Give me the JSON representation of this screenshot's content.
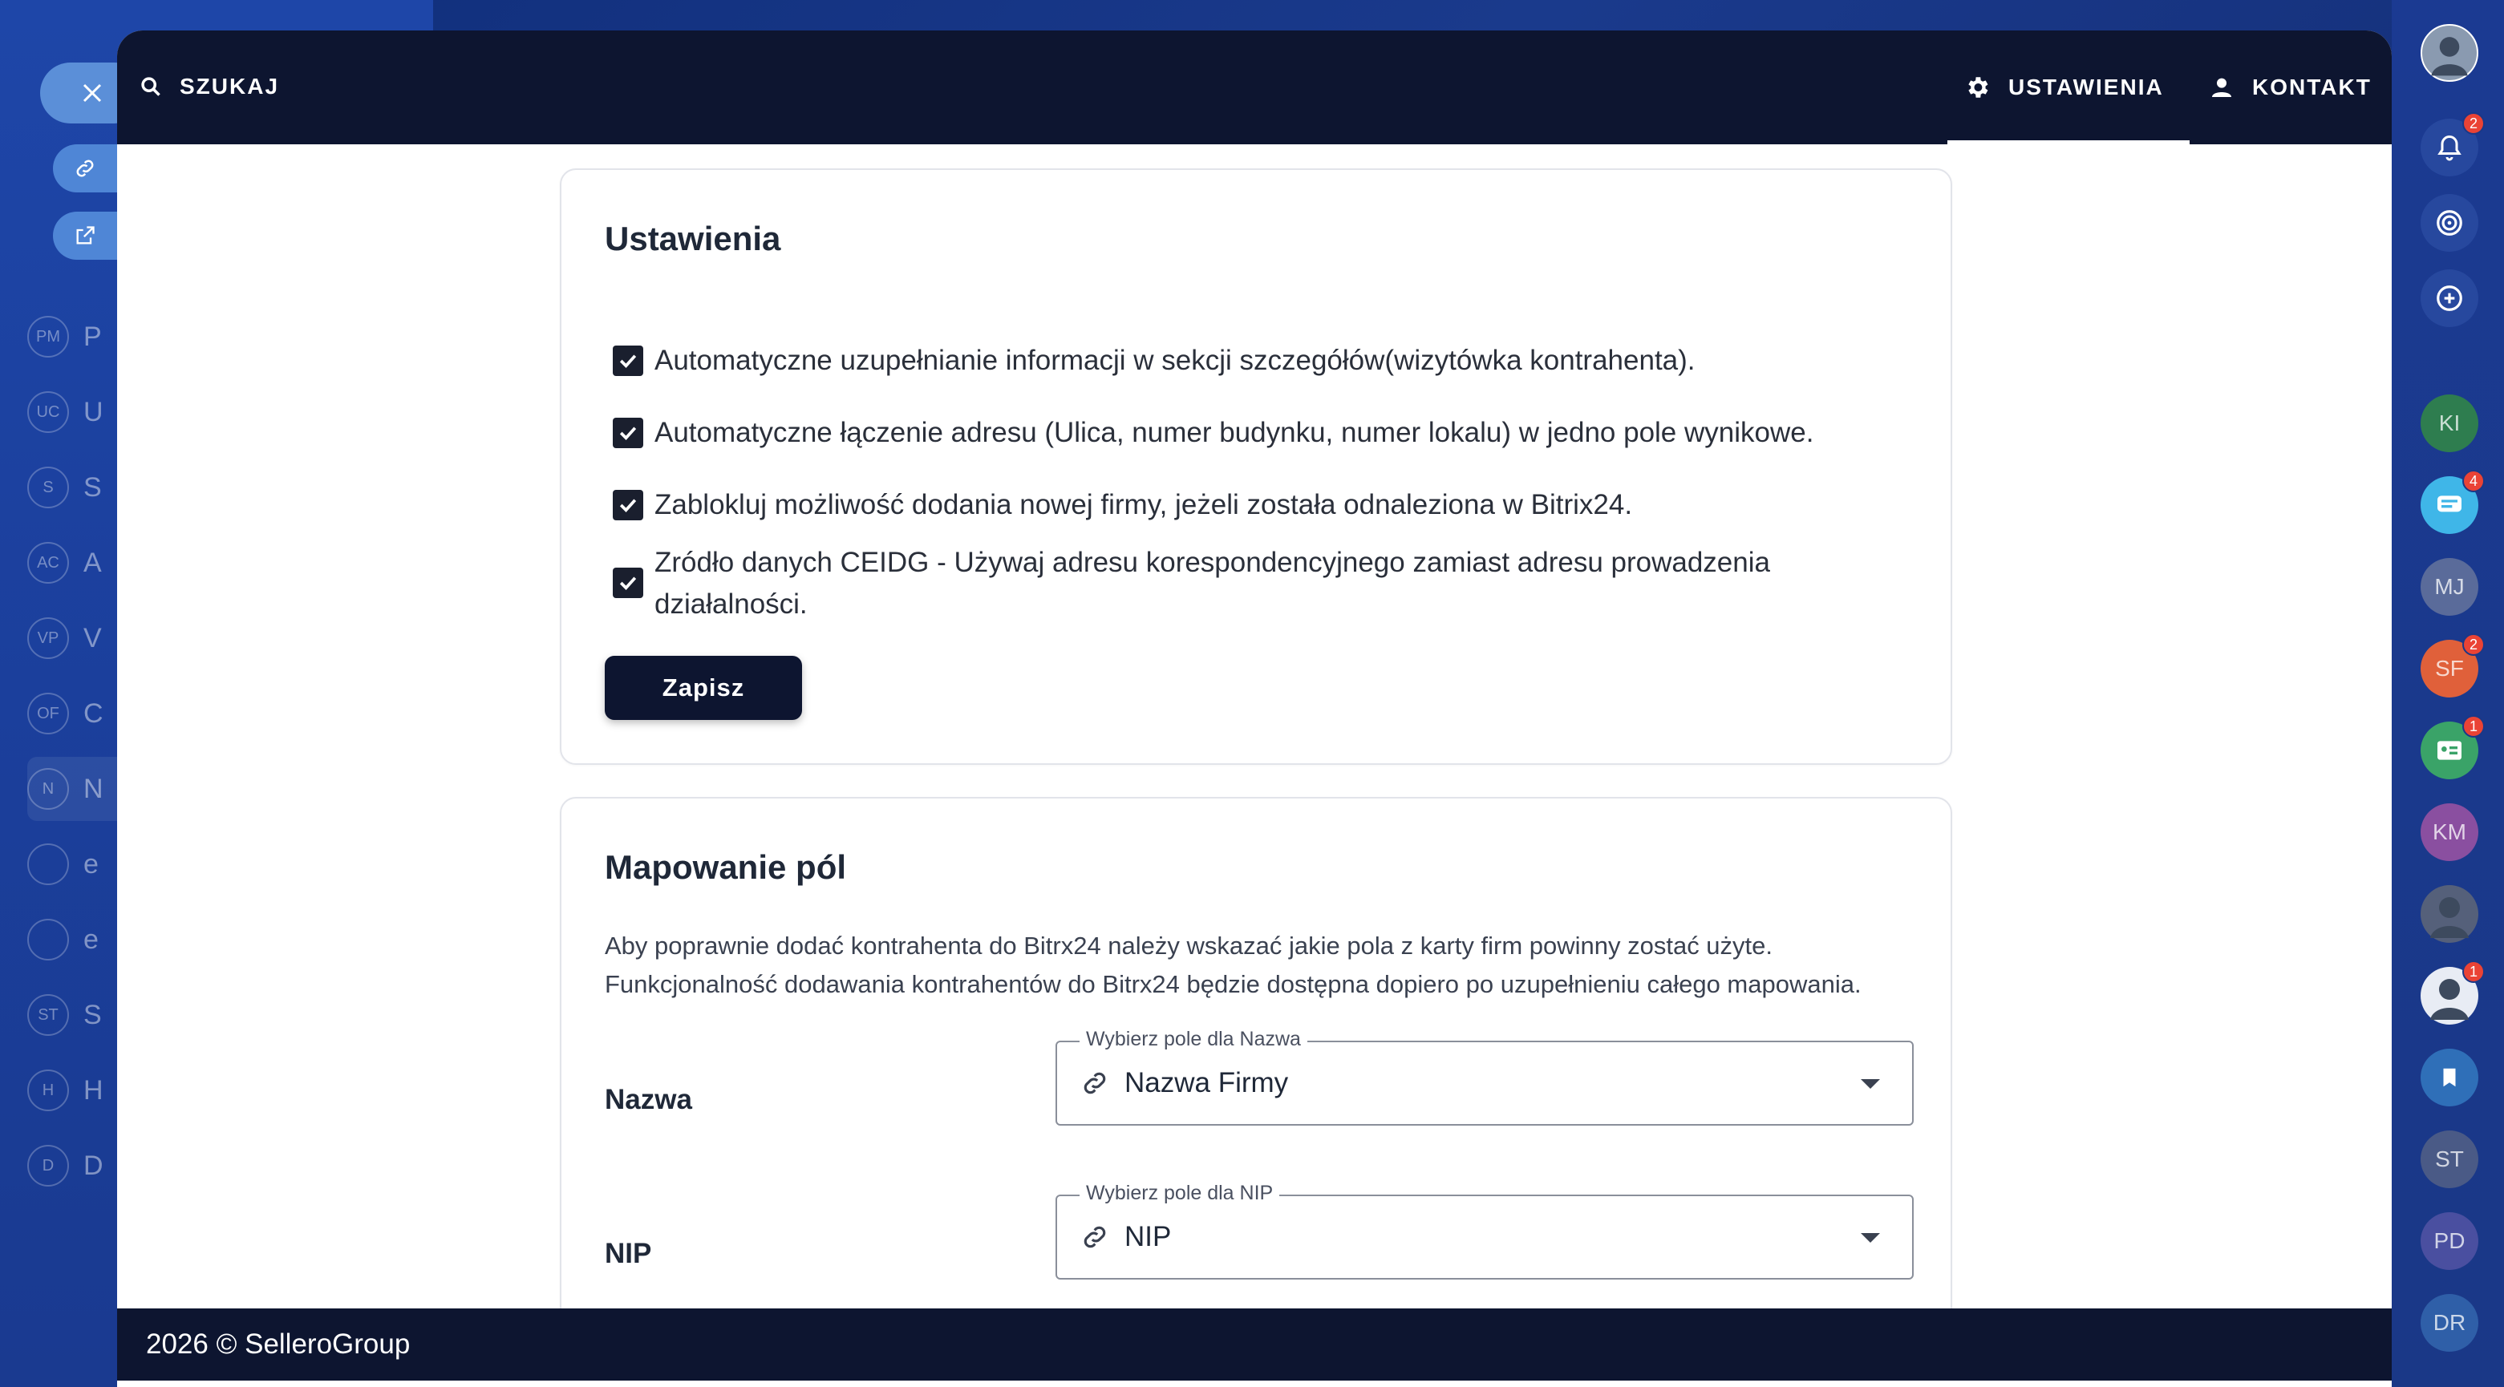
{
  "topbar": {
    "search_label": "SZUKAJ",
    "tabs": [
      {
        "label": "USTAWIENIA",
        "icon": "gear-icon",
        "active": true
      },
      {
        "label": "KONTAKT",
        "icon": "person-icon",
        "active": false
      }
    ]
  },
  "settings_card": {
    "title": "Ustawienia",
    "options": [
      {
        "label": "Automatyczne uzupełnianie informacji w sekcji szczegółów(wizytówka kontrahenta).",
        "checked": true
      },
      {
        "label": "Automatyczne łączenie adresu (Ulica, numer budynku, numer lokalu) w jedno pole wynikowe.",
        "checked": true
      },
      {
        "label": "Zablokluj możliwość dodania nowej firmy, jeżeli została odnaleziona w Bitrix24.",
        "checked": true
      },
      {
        "label": "Zródło danych CEIDG - Używaj adresu korespondencyjnego zamiast adresu prowadzenia działalności.",
        "checked": true
      }
    ],
    "save_label": "Zapisz"
  },
  "mapping_card": {
    "title": "Mapowanie pól",
    "description_1": "Aby poprawnie dodać kontrahenta do Bitrx24 należy wskazać jakie pola z karty firm powinny zostać użyte.",
    "description_2": "Funkcjonalność dodawania kontrahentów do Bitrx24 będzie dostępna dopiero po uzupełnieniu całego mapowania.",
    "fields": [
      {
        "label": "Nazwa",
        "legend": "Wybierz pole dla Nazwa",
        "value": "Nazwa Firmy"
      },
      {
        "label": "NIP",
        "legend": "Wybierz pole dla NIP",
        "value": "NIP"
      }
    ]
  },
  "footer": {
    "text": "2026 © SelleroGroup"
  },
  "background_nav": [
    {
      "initials": "PM",
      "letter": "P"
    },
    {
      "initials": "UC",
      "letter": "U"
    },
    {
      "initials": "S",
      "letter": "S"
    },
    {
      "initials": "AC",
      "letter": "A"
    },
    {
      "initials": "VP",
      "letter": "V"
    },
    {
      "initials": "OF",
      "letter": "C"
    },
    {
      "initials": "N",
      "letter": "N"
    },
    {
      "initials": "",
      "letter": "e"
    },
    {
      "initials": "",
      "letter": "e"
    },
    {
      "initials": "ST",
      "letter": "S"
    },
    {
      "initials": "H",
      "letter": "H"
    },
    {
      "initials": "D",
      "letter": "D"
    }
  ],
  "right_rail": [
    {
      "label": "",
      "icon": "bell-icon",
      "badge": "2",
      "color": "#27489e"
    },
    {
      "label": "",
      "icon": "target-icon",
      "badge": "",
      "color": "#27489e"
    },
    {
      "label": "",
      "icon": "chat-search-icon",
      "badge": "",
      "color": "#27489e"
    },
    {
      "label": "KI",
      "icon": "",
      "badge": "",
      "color": "#2e7d4f"
    },
    {
      "label": "",
      "icon": "message-icon",
      "badge": "4",
      "color": "#3fb6e8"
    },
    {
      "label": "MJ",
      "icon": "",
      "badge": "",
      "color": "#5a6b9a"
    },
    {
      "label": "SF",
      "icon": "",
      "badge": "2",
      "color": "#e0603a"
    },
    {
      "label": "",
      "icon": "contact-card-icon",
      "badge": "1",
      "color": "#3aa368"
    },
    {
      "label": "KM",
      "icon": "",
      "badge": "",
      "color": "#8a4fa0"
    },
    {
      "label": "",
      "icon": "avatar-icon",
      "badge": "",
      "color": "#55607a"
    },
    {
      "label": "",
      "icon": "avatar-icon",
      "badge": "1",
      "color": "#e8ecf4"
    },
    {
      "label": "",
      "icon": "bookmark-icon",
      "badge": "",
      "color": "#2f6fb8"
    },
    {
      "label": "ST",
      "icon": "",
      "badge": "",
      "color": "#4a5a86"
    },
    {
      "label": "PD",
      "icon": "",
      "badge": "",
      "color": "#4a4fa0"
    },
    {
      "label": "DR",
      "icon": "",
      "badge": "",
      "color": "#2f5fa8"
    }
  ]
}
